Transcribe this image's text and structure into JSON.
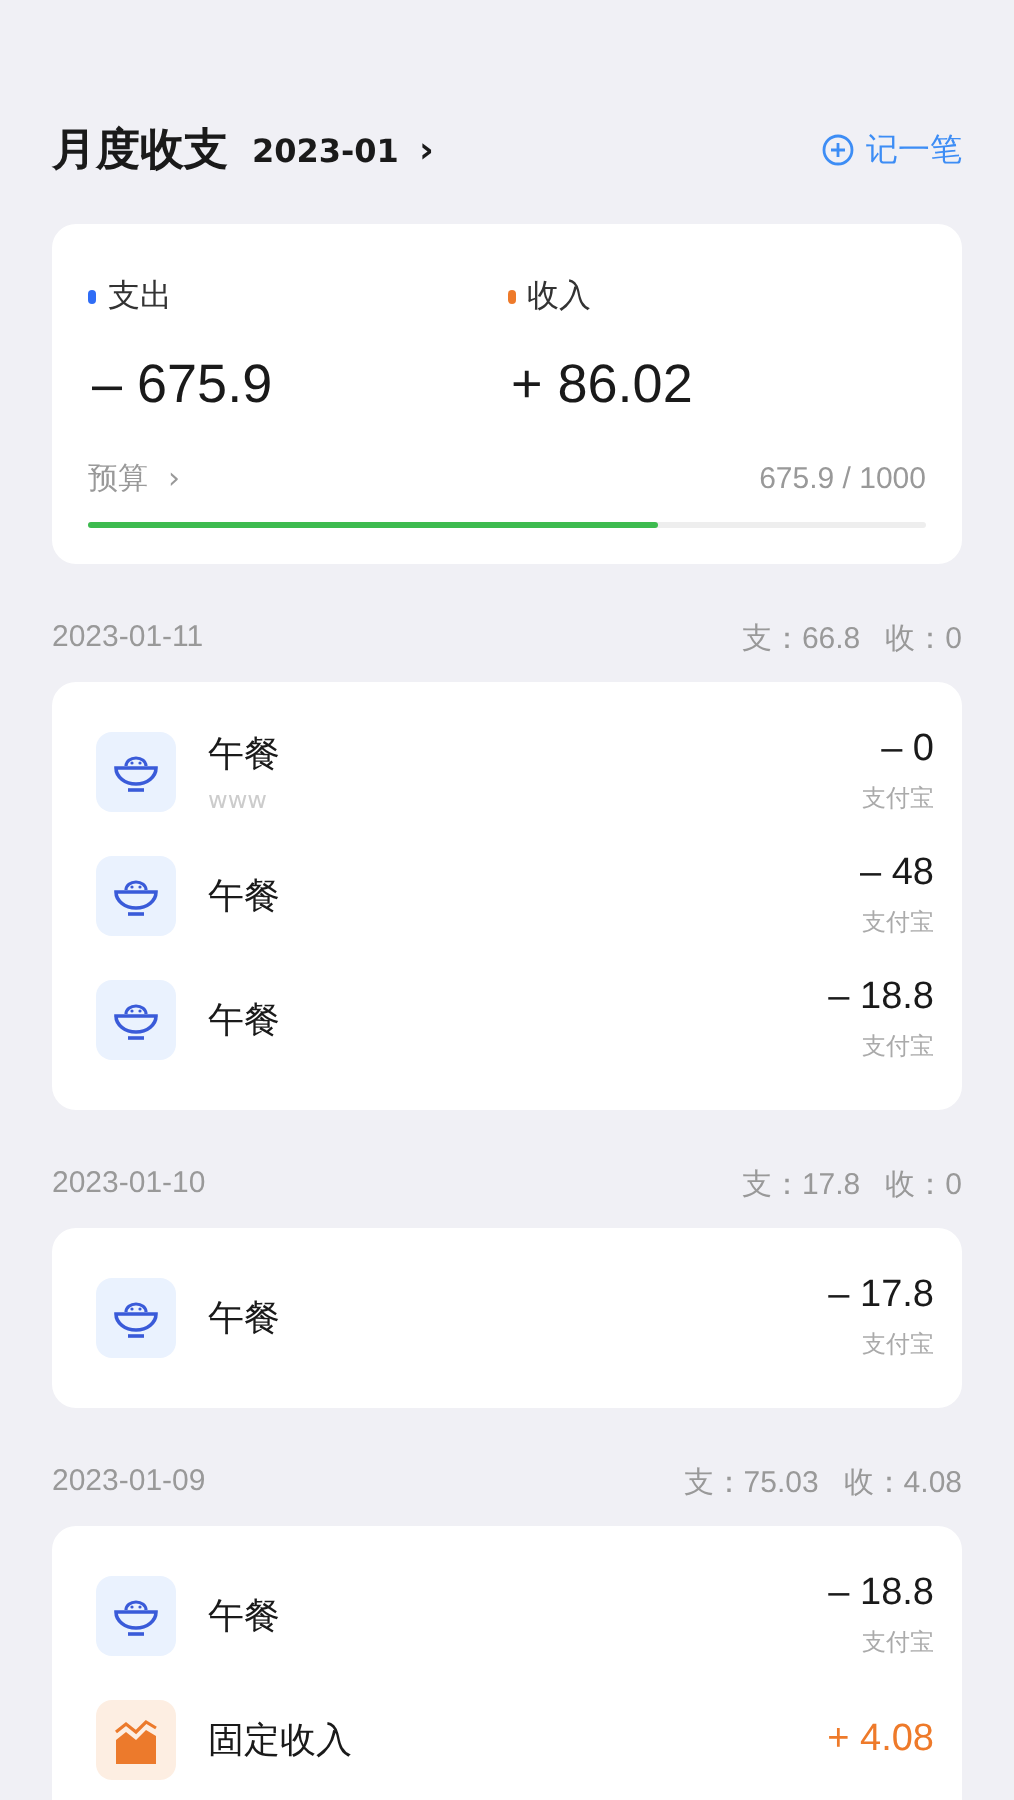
{
  "header": {
    "title": "月度收支",
    "month": "2023-01",
    "chevron": "›",
    "add_button": "记一笔"
  },
  "summary": {
    "expense": {
      "label": "支出",
      "value": "– 675.9",
      "color": "#2f6df6"
    },
    "income": {
      "label": "收入",
      "value": "+ 86.02",
      "color": "#ee7a2a"
    },
    "budget": {
      "label": "预算",
      "chevron": "›",
      "reading": "675.9 / 1000",
      "level": 0.68
    }
  },
  "days": [
    {
      "date": "2023-01-11",
      "totals": "支：66.8   收：0",
      "items": [
        {
          "kind": "expense",
          "name": "午餐",
          "note": "www",
          "amount": "– 0",
          "account": "支付宝"
        },
        {
          "kind": "expense",
          "name": "午餐",
          "amount": "– 48",
          "account": "支付宝"
        },
        {
          "kind": "expense",
          "name": "午餐",
          "amount": "– 18.8",
          "account": "支付宝"
        }
      ]
    },
    {
      "date": "2023-01-10",
      "totals": "支：17.8   收：0",
      "items": [
        {
          "kind": "expense",
          "name": "午餐",
          "amount": "– 17.8",
          "account": "支付宝"
        }
      ]
    },
    {
      "date": "2023-01-09",
      "totals": "支：75.03   收：4.08",
      "items": [
        {
          "kind": "expense",
          "name": "午餐",
          "amount": "– 18.8",
          "account": "支付宝"
        },
        {
          "kind": "income",
          "name": "固定收入",
          "amount": "+ 4.08"
        }
      ]
    }
  ]
}
